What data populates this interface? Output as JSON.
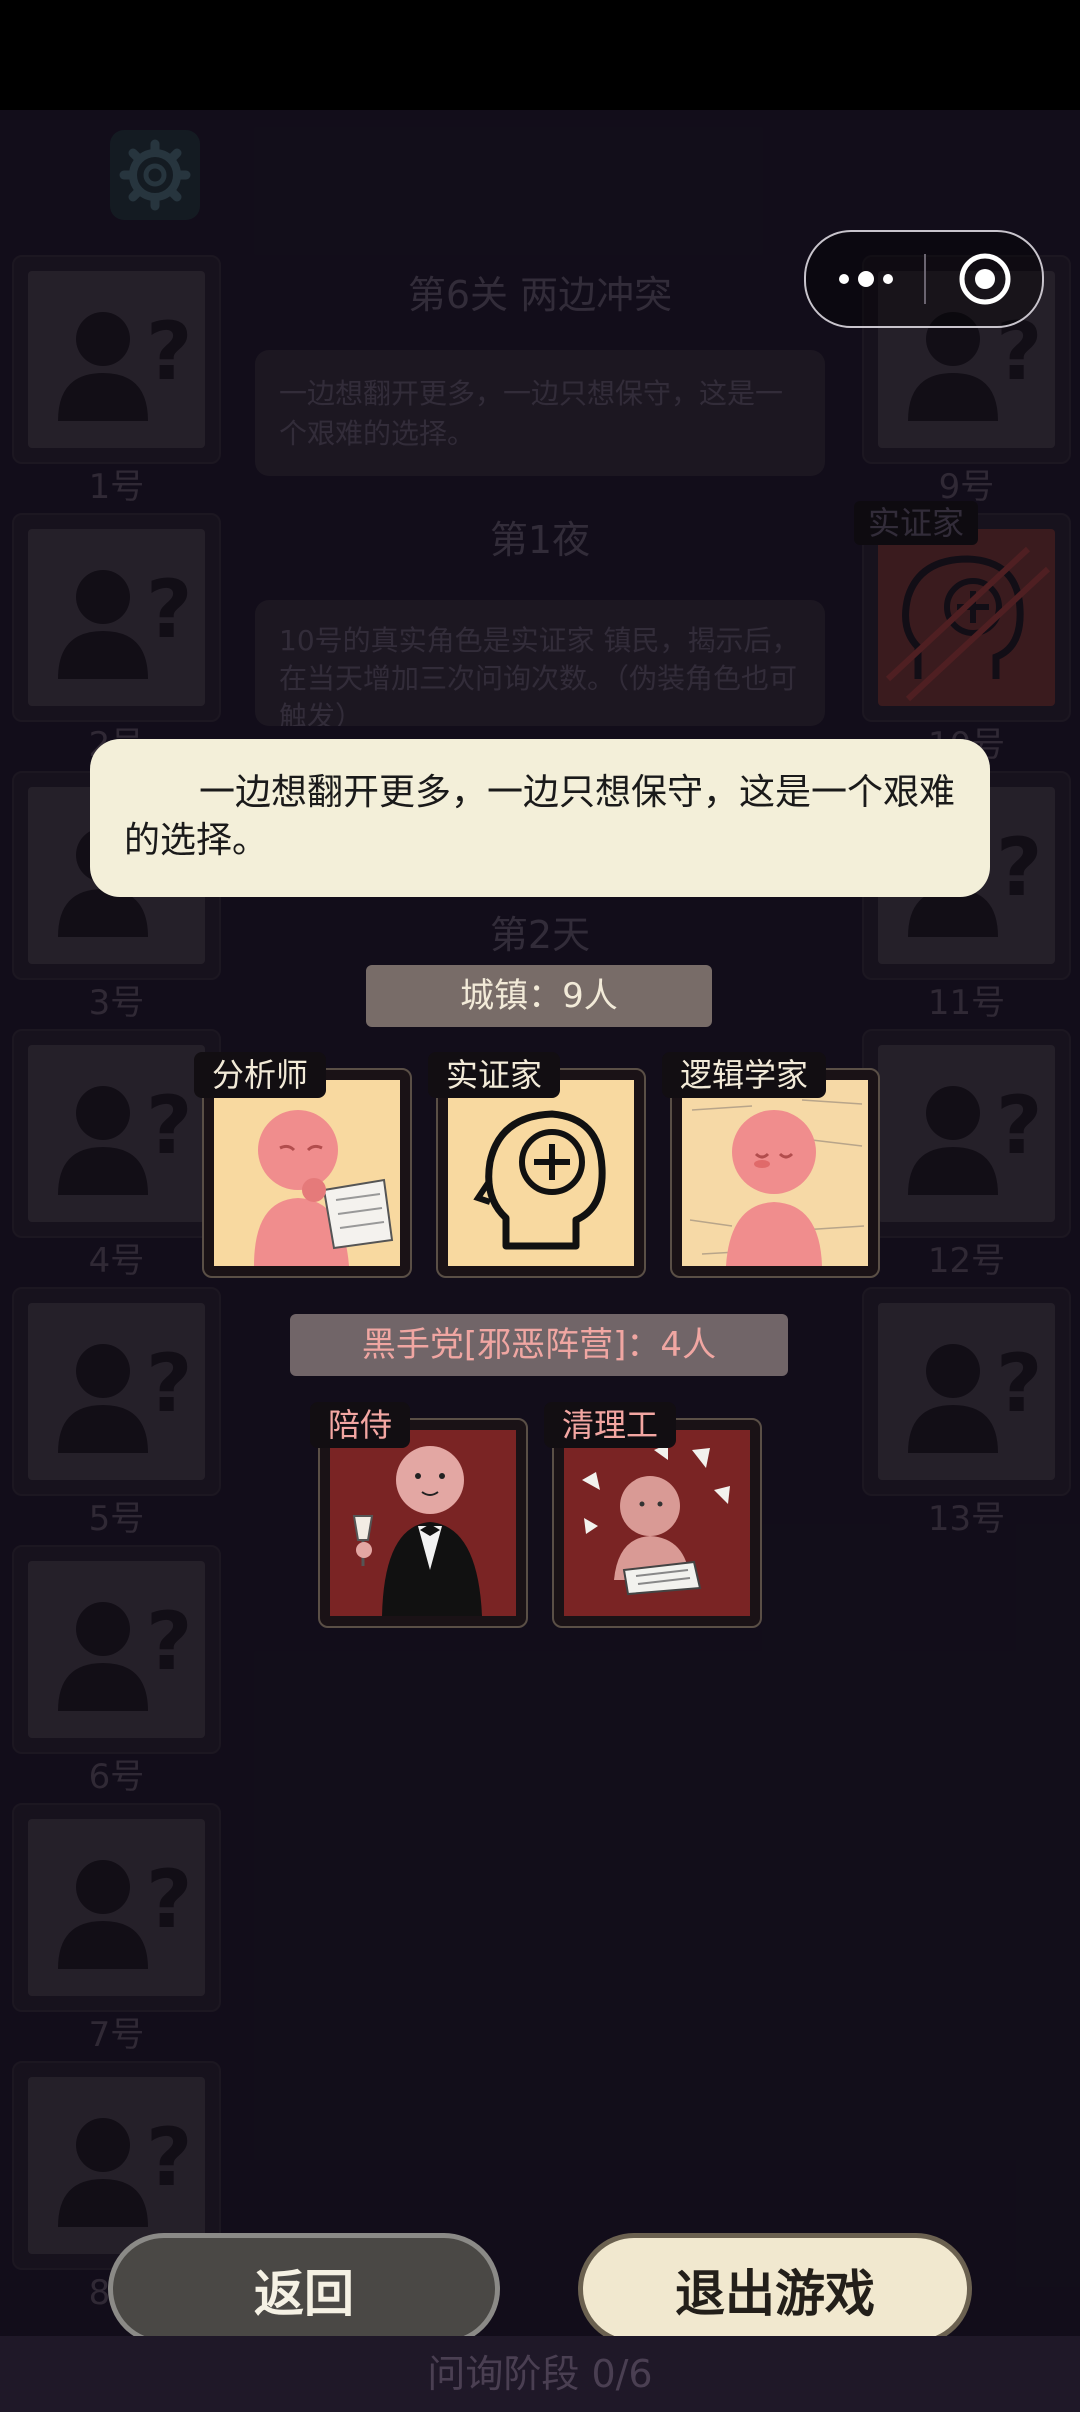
{
  "game": {
    "level_title": "第6关 两边冲突",
    "level_desc": "一边想翻开更多，一边只想保守，这是一个艰难的选择。",
    "night_label": "第1夜",
    "night_log": "10号的真实角色是实证家 镇民，揭示后，在当天增加三次问询次数。（伪装角色也可触发）",
    "day_label": "第2天",
    "revealed_seat_role": "实证家",
    "phase_label": "问询阶段 0/6",
    "seats": [
      "1号",
      "2号",
      "3号",
      "4号",
      "5号",
      "6号",
      "7号",
      "8号",
      "9号",
      "10号",
      "11号",
      "12号",
      "13号"
    ]
  },
  "dialog": {
    "text": "一边想翻开更多，一边只想保守，这是一个艰难的选择。"
  },
  "town": {
    "label": "城镇：9人",
    "roles": [
      {
        "name": "分析师",
        "icon": "analyst-portrait-icon"
      },
      {
        "name": "实证家",
        "icon": "head-plus-icon"
      },
      {
        "name": "逻辑学家",
        "icon": "logician-portrait-icon"
      }
    ]
  },
  "evil": {
    "label": "黑手党[邪恶阵营]：4人",
    "roles": [
      {
        "name": "陪侍",
        "icon": "butler-portrait-icon"
      },
      {
        "name": "清理工",
        "icon": "cleaner-portrait-icon"
      }
    ]
  },
  "buttons": {
    "back": "返回",
    "exit": "退出游戏"
  },
  "colors": {
    "dialog_bg": "#f3efd9",
    "town_card_bg": "#f8d9a0",
    "evil_card_bg": "#7a2424",
    "evil_text": "#f3a6a2"
  }
}
